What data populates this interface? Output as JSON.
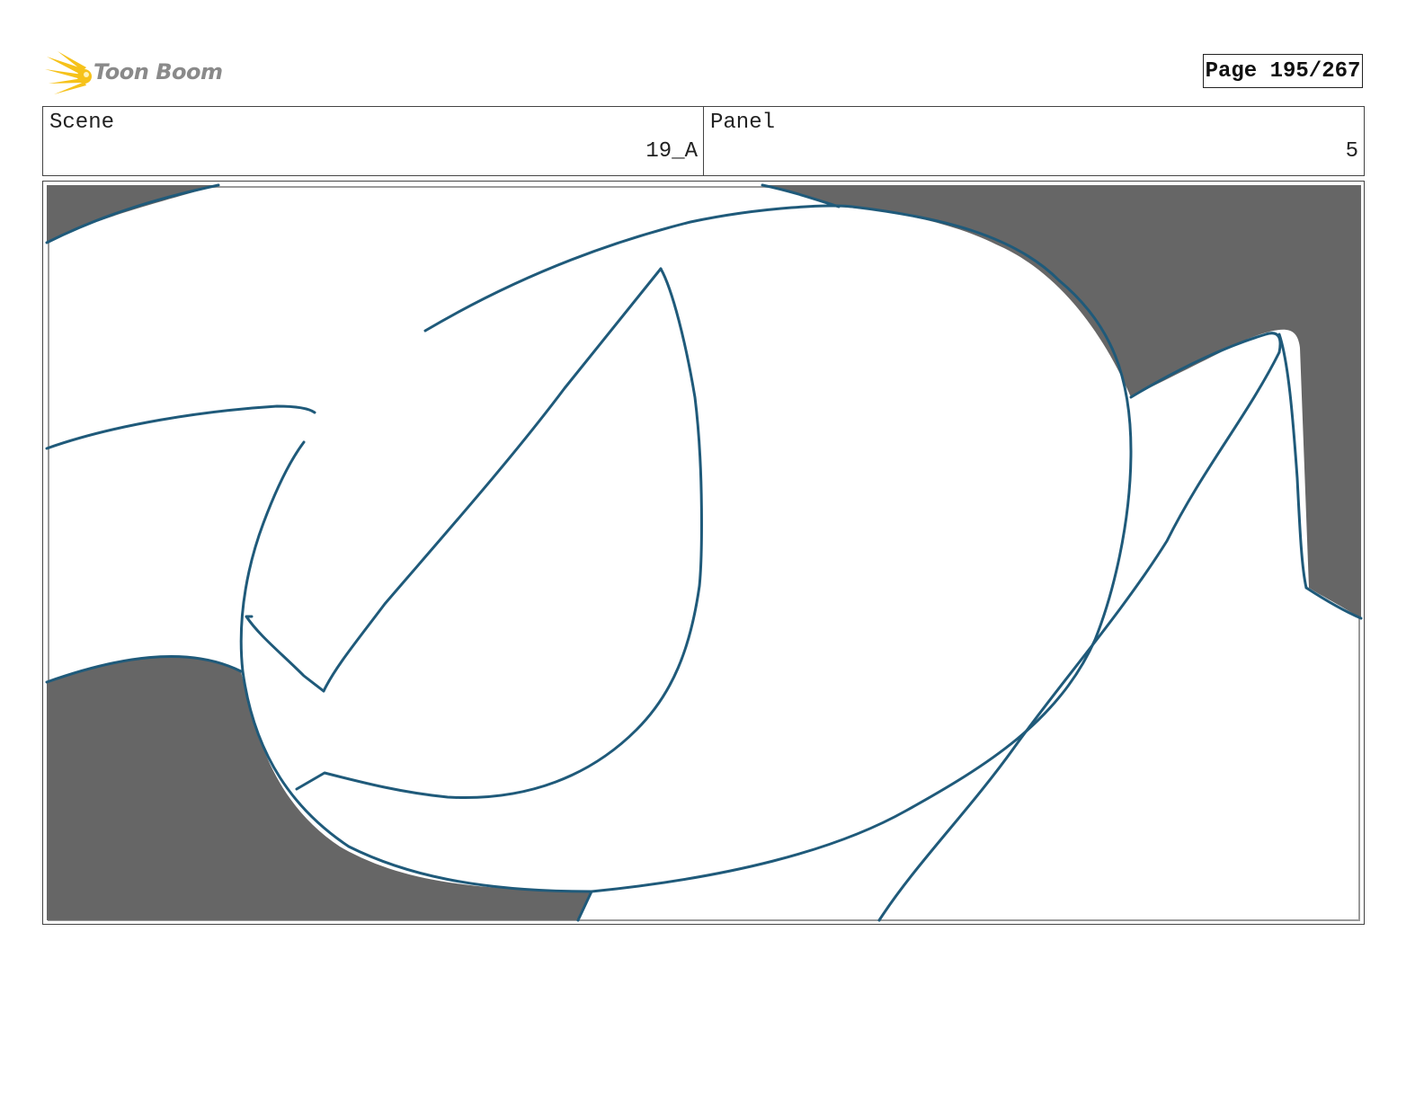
{
  "header": {
    "logo_text": "Toon Boom",
    "page_label": "Page 195/267"
  },
  "info": {
    "scene_label": "Scene",
    "scene_value": "19_A",
    "panel_label": "Panel",
    "panel_value": "5"
  },
  "artwork": {
    "description_icon": "storyboard-panel-drawing",
    "fill_color": "#666666",
    "line_color": "#1f5a7a"
  }
}
